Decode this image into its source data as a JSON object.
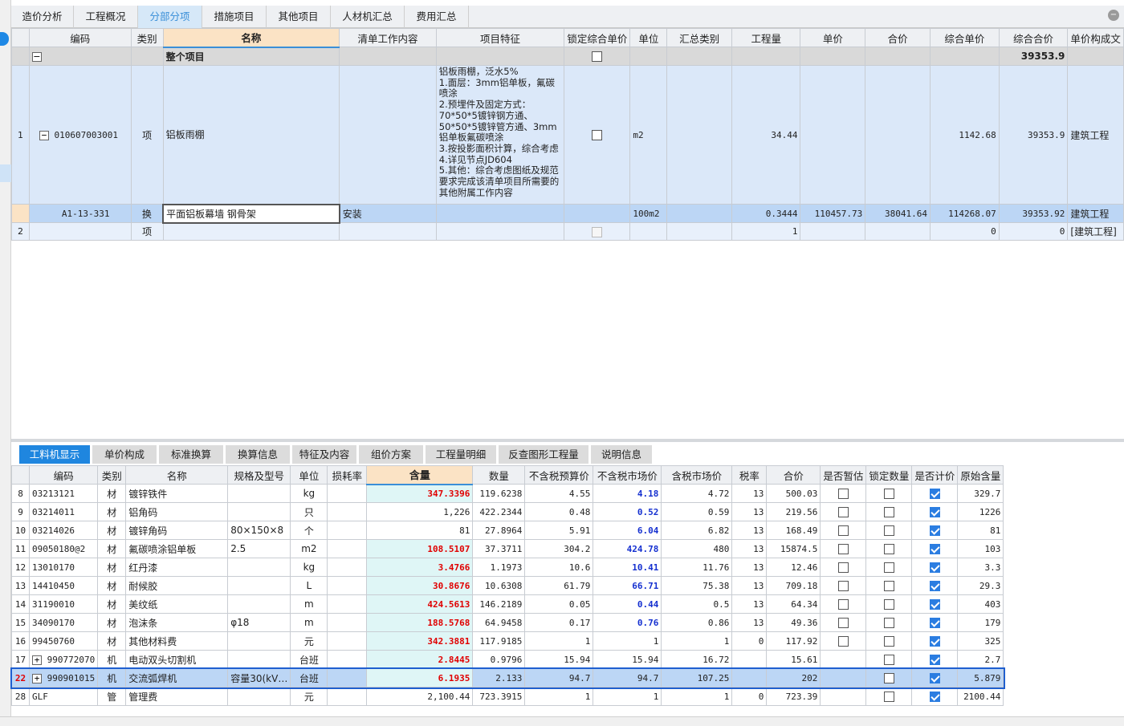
{
  "tabs": [
    "造价分析",
    "工程概况",
    "分部分项",
    "措施项目",
    "其他项目",
    "人材机汇总",
    "费用汇总"
  ],
  "active_tab": "分部分项",
  "upper": {
    "headers": [
      "编码",
      "类别",
      "名称",
      "清单工作内容",
      "项目特征",
      "锁定综合单价",
      "单位",
      "汇总类别",
      "工程量",
      "单价",
      "合价",
      "综合单价",
      "综合合价",
      "单价构成文"
    ],
    "total_row": {
      "name": "整个项目",
      "total": "39353.9"
    },
    "item1": {
      "no": "1",
      "code": "010607003001",
      "type": "项",
      "name": "铝板雨棚",
      "features": "铝板雨棚，泛水5%\n1.面层：3mm铝单板，氟碳喷涂\n2.预埋件及固定方式：70*50*5镀锌钢方通、50*50*5镀锌管方通、3mm铝单板氟碳喷涂\n3.按投影面积计算，综合考虑\n4.详见节点JD604\n5.其他：综合考虑图纸及规范要求完成该清单项目所需要的其他附属工作内容",
      "unit": "m2",
      "qty": "34.44",
      "comp_price": "1142.68",
      "comp_total": "39353.9",
      "composition": "建筑工程"
    },
    "sub1": {
      "code": "A1-13-331",
      "type": "换",
      "name": "平面铝板幕墙 钢骨架",
      "work": "安装",
      "unit": "100m2",
      "qty": "0.3444",
      "price": "110457.73",
      "total": "38041.64",
      "comp_price": "114268.07",
      "comp_total": "39353.92",
      "composition": "建筑工程"
    },
    "item2": {
      "no": "2",
      "type": "项",
      "qty": "1",
      "comp_price": "0",
      "comp_total": "0",
      "composition": "[建筑工程]"
    }
  },
  "lower_tabs": [
    "工料机显示",
    "单价构成",
    "标准换算",
    "换算信息",
    "特征及内容",
    "组价方案",
    "工程量明细",
    "反查图形工程量",
    "说明信息"
  ],
  "lower_active": "工料机显示",
  "lower": {
    "headers": [
      "编码",
      "类别",
      "名称",
      "规格及型号",
      "单位",
      "损耗率",
      "含量",
      "数量",
      "不含税预算价",
      "不含税市场价",
      "含税市场价",
      "税率",
      "合价",
      "是否暂估",
      "锁定数量",
      "是否计价",
      "原始含量"
    ],
    "rows": [
      {
        "no": "8",
        "code": "03213121",
        "type": "材",
        "name": "镀锌铁件",
        "spec": "",
        "unit": "kg",
        "qty": "347.3396",
        "amount": "119.6238",
        "budget": "4.55",
        "market": "4.18",
        "taxmarket": "4.72",
        "rate": "13",
        "total": "500.03",
        "est": false,
        "lock": false,
        "priced": true,
        "orig": "329.7",
        "expand": false,
        "highlight_qty": true
      },
      {
        "no": "9",
        "code": "03214011",
        "type": "材",
        "name": "铝角码",
        "spec": "",
        "unit": "只",
        "qty": "1,226",
        "amount": "422.2344",
        "budget": "0.48",
        "market": "0.52",
        "taxmarket": "0.59",
        "rate": "13",
        "total": "219.56",
        "est": false,
        "lock": false,
        "priced": true,
        "orig": "1226",
        "expand": false,
        "highlight_qty": false
      },
      {
        "no": "10",
        "code": "03214026",
        "type": "材",
        "name": "镀锌角码",
        "spec": "80×150×8",
        "unit": "个",
        "qty": "81",
        "amount": "27.8964",
        "budget": "5.91",
        "market": "6.04",
        "taxmarket": "6.82",
        "rate": "13",
        "total": "168.49",
        "est": false,
        "lock": false,
        "priced": true,
        "orig": "81",
        "expand": false,
        "highlight_qty": false
      },
      {
        "no": "11",
        "code": "09050180@2",
        "type": "材",
        "name": "氟碳喷涂铝单板",
        "spec": "2.5",
        "unit": "m2",
        "qty": "108.5107",
        "amount": "37.3711",
        "budget": "304.2",
        "market": "424.78",
        "taxmarket": "480",
        "rate": "13",
        "total": "15874.5",
        "est": false,
        "lock": false,
        "priced": true,
        "orig": "103",
        "expand": false,
        "highlight_qty": true
      },
      {
        "no": "12",
        "code": "13010170",
        "type": "材",
        "name": "红丹漆",
        "spec": "",
        "unit": "kg",
        "qty": "3.4766",
        "amount": "1.1973",
        "budget": "10.6",
        "market": "10.41",
        "taxmarket": "11.76",
        "rate": "13",
        "total": "12.46",
        "est": false,
        "lock": false,
        "priced": true,
        "orig": "3.3",
        "expand": false,
        "highlight_qty": true
      },
      {
        "no": "13",
        "code": "14410450",
        "type": "材",
        "name": "耐候胶",
        "spec": "",
        "unit": "L",
        "qty": "30.8676",
        "amount": "10.6308",
        "budget": "61.79",
        "market": "66.71",
        "taxmarket": "75.38",
        "rate": "13",
        "total": "709.18",
        "est": false,
        "lock": false,
        "priced": true,
        "orig": "29.3",
        "expand": false,
        "highlight_qty": true
      },
      {
        "no": "14",
        "code": "31190010",
        "type": "材",
        "name": "美纹纸",
        "spec": "",
        "unit": "m",
        "qty": "424.5613",
        "amount": "146.2189",
        "budget": "0.05",
        "market": "0.44",
        "taxmarket": "0.5",
        "rate": "13",
        "total": "64.34",
        "est": false,
        "lock": false,
        "priced": true,
        "orig": "403",
        "expand": false,
        "highlight_qty": true
      },
      {
        "no": "15",
        "code": "34090170",
        "type": "材",
        "name": "泡沫条",
        "spec": "φ18",
        "unit": "m",
        "qty": "188.5768",
        "amount": "64.9458",
        "budget": "0.17",
        "market": "0.76",
        "taxmarket": "0.86",
        "rate": "13",
        "total": "49.36",
        "est": false,
        "lock": false,
        "priced": true,
        "orig": "179",
        "expand": false,
        "highlight_qty": true
      },
      {
        "no": "16",
        "code": "99450760",
        "type": "材",
        "name": "其他材料费",
        "spec": "",
        "unit": "元",
        "qty": "342.3881",
        "amount": "117.9185",
        "budget": "1",
        "market": "1",
        "taxmarket": "1",
        "rate": "0",
        "total": "117.92",
        "est": false,
        "lock": false,
        "priced": true,
        "orig": "325",
        "expand": false,
        "highlight_qty": true,
        "market_plain": true
      },
      {
        "no": "17",
        "code": "990772070",
        "type": "机",
        "name": "电动双头切割机",
        "spec": "",
        "unit": "台班",
        "qty": "2.8445",
        "amount": "0.9796",
        "budget": "15.94",
        "market": "15.94",
        "taxmarket": "16.72",
        "rate": "",
        "total": "15.61",
        "est": null,
        "lock": false,
        "priced": true,
        "orig": "2.7",
        "expand": true,
        "highlight_qty": true,
        "market_plain": true
      },
      {
        "no": "22",
        "code": "990901015",
        "type": "机",
        "name": "交流弧焊机",
        "spec": "容量30(kV…",
        "unit": "台班",
        "qty": "6.1935",
        "amount": "2.133",
        "budget": "94.7",
        "market": "94.7",
        "taxmarket": "107.25",
        "rate": "",
        "total": "202",
        "est": null,
        "lock": false,
        "priced": true,
        "orig": "5.879",
        "expand": true,
        "highlight_qty": true,
        "market_plain": true,
        "selected": true
      },
      {
        "no": "28",
        "code": "GLF",
        "type": "管",
        "name": "管理费",
        "spec": "",
        "unit": "元",
        "qty": "2,100.44",
        "amount": "723.3915",
        "budget": "1",
        "market": "1",
        "taxmarket": "1",
        "rate": "0",
        "total": "723.39",
        "est": null,
        "lock": false,
        "priced": true,
        "orig": "2100.44",
        "expand": false,
        "highlight_qty": false,
        "market_plain": true
      }
    ]
  }
}
